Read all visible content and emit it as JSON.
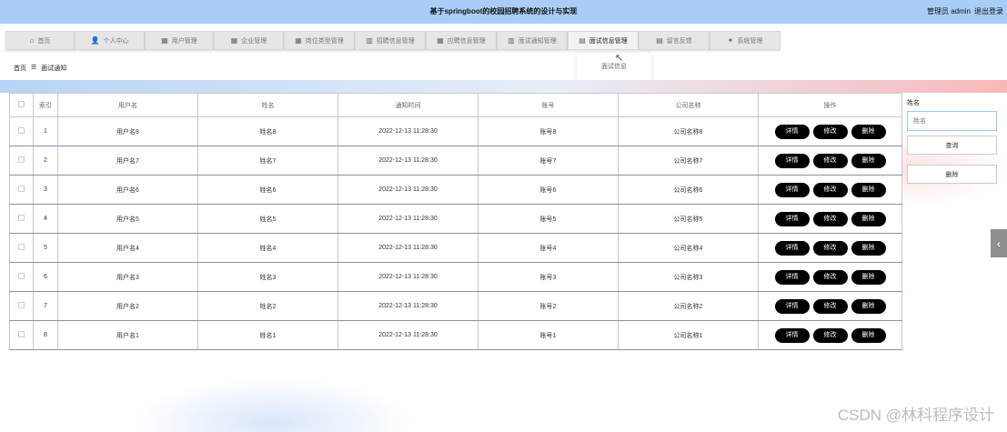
{
  "header": {
    "title": "基于springboot的校园招聘系统的设计与实现",
    "user": "管理员 admin",
    "logout": "退出登录"
  },
  "nav": [
    {
      "icon": "⌂",
      "label": "首页",
      "icon_name": "home-icon"
    },
    {
      "icon": "👤",
      "label": "个人中心",
      "icon_name": "user-icon"
    },
    {
      "icon": "▦",
      "label": "用户管理",
      "icon_name": "users-icon"
    },
    {
      "icon": "▦",
      "label": "企业管理",
      "icon_name": "grid-icon"
    },
    {
      "icon": "▦",
      "label": "岗位类型管理",
      "icon_name": "apps-icon"
    },
    {
      "icon": "▥",
      "label": "招聘信息管理",
      "icon_name": "bar-icon"
    },
    {
      "icon": "▦",
      "label": "应聘信息管理",
      "icon_name": "apps-icon"
    },
    {
      "icon": "▥",
      "label": "面试通知管理",
      "icon_name": "chart-icon"
    },
    {
      "icon": "▤",
      "label": "面试信息管理",
      "icon_name": "document-icon"
    },
    {
      "icon": "▤",
      "label": "留言反馈",
      "icon_name": "message-icon"
    },
    {
      "icon": "✦",
      "label": "系统管理",
      "icon_name": "settings-icon"
    }
  ],
  "dropdown": {
    "item": "面试信息"
  },
  "breadcrumb": {
    "home": "首页",
    "sep": "☰",
    "current": "面试通知"
  },
  "table": {
    "headers": [
      "索引",
      "用户名",
      "姓名",
      "通知时间",
      "账号",
      "公司名称",
      "操作"
    ],
    "rows": [
      {
        "index": "1",
        "username": "用户名8",
        "name": "姓名8",
        "time": "2022-12-13 11:28:30",
        "account": "账号8",
        "company": "公司名称8"
      },
      {
        "index": "2",
        "username": "用户名7",
        "name": "姓名7",
        "time": "2022-12-13 11:28:30",
        "account": "账号7",
        "company": "公司名称7"
      },
      {
        "index": "3",
        "username": "用户名6",
        "name": "姓名6",
        "time": "2022-12-13 11:28:30",
        "account": "账号6",
        "company": "公司名称6"
      },
      {
        "index": "4",
        "username": "用户名5",
        "name": "姓名5",
        "time": "2022-12-13 11:28:30",
        "account": "账号5",
        "company": "公司名称5"
      },
      {
        "index": "5",
        "username": "用户名4",
        "name": "姓名4",
        "time": "2022-12-13 11:28:30",
        "account": "账号4",
        "company": "公司名称4"
      },
      {
        "index": "6",
        "username": "用户名3",
        "name": "姓名3",
        "time": "2022-12-13 11:28:30",
        "account": "账号3",
        "company": "公司名称3"
      },
      {
        "index": "7",
        "username": "用户名2",
        "name": "姓名2",
        "time": "2022-12-13 11:28:30",
        "account": "账号2",
        "company": "公司名称2"
      },
      {
        "index": "8",
        "username": "用户名1",
        "name": "姓名1",
        "time": "2022-12-13 11:28:30",
        "account": "账号1",
        "company": "公司名称1"
      }
    ],
    "actions": {
      "detail": "详情",
      "edit": "修改",
      "delete": "删除"
    }
  },
  "search": {
    "label": "姓名",
    "placeholder": "姓名",
    "query_button": "查询",
    "delete_button": "删除"
  },
  "watermark": "CSDN @林科程序设计"
}
